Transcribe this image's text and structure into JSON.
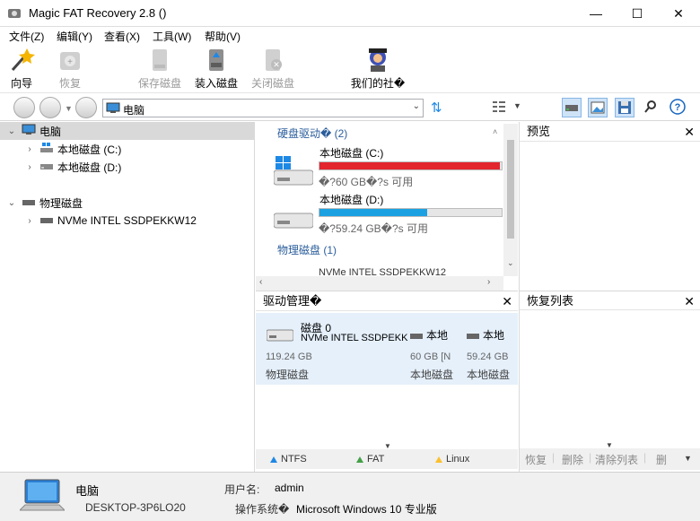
{
  "window": {
    "title": "Magic FAT Recovery 2.8 ()",
    "minimize": "—",
    "maximize": "☐",
    "close": "✕"
  },
  "menu": [
    "文件(Z)",
    "编辑(Y)",
    "查看(X)",
    "工具(W)",
    "帮助(V)"
  ],
  "toolbar": {
    "wizard": "向导",
    "recover": "恢复",
    "save_disk": "保存磁盘",
    "mount_disk": "装入磁盘",
    "close_disk": "关闭磁盘",
    "community": "我们的社�"
  },
  "address": {
    "value": "电脑"
  },
  "tree": {
    "root": "电脑",
    "c_drive": "本地磁盘 (C:)",
    "d_drive": "本地磁盘 (D:)",
    "physical": "物理磁盘",
    "nvme": "NVMe INTEL SSDPEKKW12"
  },
  "drives": {
    "hdd_group": "硬盘驱动� (2)",
    "c_name": "本地磁盘 (C:)",
    "c_free": "�?60 GB�?s 可用",
    "c_fill": 0.99,
    "d_name": "本地磁盘 (D:)",
    "d_free": "�?59.24 GB�?s 可用",
    "d_fill": 0.59,
    "phys_group": "物理磁盘 (1)",
    "phys_partial": "NVMe INTEL SSDPEKKW12"
  },
  "drive_mgmt": {
    "title": "驱动管理�",
    "disk_name": "磁盘 0",
    "disk_model": "NVMe INTEL SSDPEKK",
    "disk_size": "119.24 GB",
    "disk_type": "物理磁盘",
    "p1_name": "本地",
    "p1_size": "60 GB [N",
    "p1_type": "本地磁盘",
    "p2_name": "本地",
    "p2_size": "59.24 GB",
    "p2_type": "本地磁盘",
    "fs_ntfs": "NTFS",
    "fs_fat": "FAT",
    "fs_linux": "Linux"
  },
  "preview": {
    "title": "预览"
  },
  "recovery_list": {
    "title": "恢复列表",
    "recover": "恢复",
    "delete": "删除",
    "clear": "清除列表",
    "more": "删"
  },
  "status": {
    "name": "电脑",
    "host": "DESKTOP-3P6LO20",
    "user_label": "用户名:",
    "user": "admin",
    "os_label": "操作系统�",
    "os": "Microsoft Windows 10 专业版"
  },
  "colors": {
    "c_bar": "#e3252e",
    "d_bar": "#1ba1e2",
    "ntfs": "#1e88e5",
    "fat": "#43a047",
    "linux": "#fbc02d"
  }
}
